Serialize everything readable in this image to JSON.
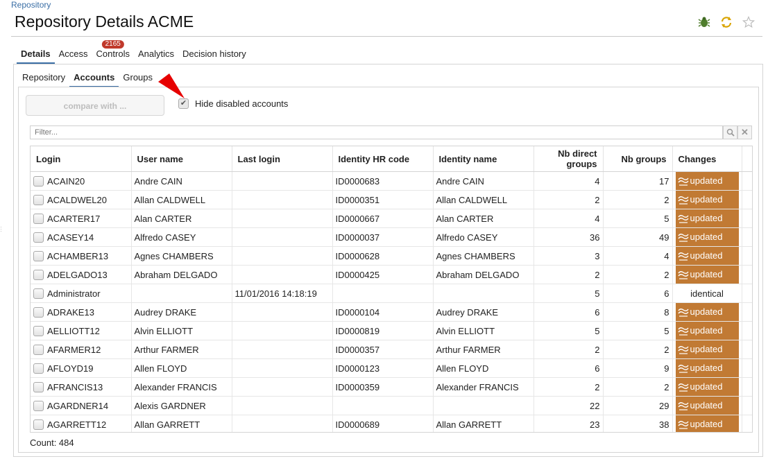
{
  "breadcrumb": "Repository",
  "page_title": "Repository Details ACME",
  "header_icons": [
    "bug-icon",
    "refresh-icon",
    "star-icon"
  ],
  "main_tabs": [
    {
      "label": "Details",
      "active": true
    },
    {
      "label": "Access",
      "active": false
    },
    {
      "label": "Controls",
      "active": false,
      "badge": "2165"
    },
    {
      "label": "Analytics",
      "active": false
    },
    {
      "label": "Decision history",
      "active": false
    }
  ],
  "sub_tabs": [
    {
      "label": "Repository",
      "active": false
    },
    {
      "label": "Accounts",
      "active": true
    },
    {
      "label": "Groups",
      "active": false
    }
  ],
  "toolbar": {
    "compare_label": "compare with ...",
    "hide_disabled_label": "Hide disabled accounts",
    "hide_disabled_checked": true
  },
  "filter": {
    "placeholder": "Filter..."
  },
  "columns": [
    "Login",
    "User name",
    "Last login",
    "Identity HR code",
    "Identity name",
    "Nb direct groups",
    "Nb groups",
    "Changes"
  ],
  "rows": [
    {
      "login": "ACAIN20",
      "user": "Andre CAIN",
      "last": "",
      "hr": "ID0000683",
      "identity": "Andre CAIN",
      "direct": "4",
      "groups": "17",
      "change": "updated"
    },
    {
      "login": "ACALDWEL20",
      "user": "Allan CALDWELL",
      "last": "",
      "hr": "ID0000351",
      "identity": "Allan CALDWELL",
      "direct": "2",
      "groups": "2",
      "change": "updated"
    },
    {
      "login": "ACARTER17",
      "user": "Alan CARTER",
      "last": "",
      "hr": "ID0000667",
      "identity": "Alan CARTER",
      "direct": "4",
      "groups": "5",
      "change": "updated"
    },
    {
      "login": "ACASEY14",
      "user": "Alfredo CASEY",
      "last": "",
      "hr": "ID0000037",
      "identity": "Alfredo CASEY",
      "direct": "36",
      "groups": "49",
      "change": "updated"
    },
    {
      "login": "ACHAMBER13",
      "user": "Agnes CHAMBERS",
      "last": "",
      "hr": "ID0000628",
      "identity": "Agnes CHAMBERS",
      "direct": "3",
      "groups": "4",
      "change": "updated"
    },
    {
      "login": "ADELGADO13",
      "user": "Abraham DELGADO",
      "last": "",
      "hr": "ID0000425",
      "identity": "Abraham DELGADO",
      "direct": "2",
      "groups": "2",
      "change": "updated"
    },
    {
      "login": "Administrator",
      "user": "",
      "last": "11/01/2016 14:18:19",
      "hr": "",
      "identity": "",
      "direct": "5",
      "groups": "6",
      "change": "identical"
    },
    {
      "login": "ADRAKE13",
      "user": "Audrey DRAKE",
      "last": "",
      "hr": "ID0000104",
      "identity": "Audrey DRAKE",
      "direct": "6",
      "groups": "8",
      "change": "updated"
    },
    {
      "login": "AELLIOTT12",
      "user": "Alvin ELLIOTT",
      "last": "",
      "hr": "ID0000819",
      "identity": "Alvin ELLIOTT",
      "direct": "5",
      "groups": "5",
      "change": "updated"
    },
    {
      "login": "AFARMER12",
      "user": "Arthur FARMER",
      "last": "",
      "hr": "ID0000357",
      "identity": "Arthur FARMER",
      "direct": "2",
      "groups": "2",
      "change": "updated"
    },
    {
      "login": "AFLOYD19",
      "user": "Allen FLOYD",
      "last": "",
      "hr": "ID0000123",
      "identity": "Allen FLOYD",
      "direct": "6",
      "groups": "9",
      "change": "updated"
    },
    {
      "login": "AFRANCIS13",
      "user": "Alexander FRANCIS",
      "last": "",
      "hr": "ID0000359",
      "identity": "Alexander FRANCIS",
      "direct": "2",
      "groups": "2",
      "change": "updated"
    },
    {
      "login": "AGARDNER14",
      "user": "Alexis GARDNER",
      "last": "",
      "hr": "",
      "identity": "",
      "direct": "22",
      "groups": "29",
      "change": "updated"
    },
    {
      "login": "AGARRETT12",
      "user": "Allan GARRETT",
      "last": "",
      "hr": "ID0000689",
      "identity": "Allan GARRETT",
      "direct": "23",
      "groups": "38",
      "change": "updated"
    }
  ],
  "count_label": "Count: 484",
  "colors": {
    "accent": "#3a6ea5",
    "updated": "#c17a34",
    "badge": "#c0392b",
    "arrow": "#e60000"
  }
}
